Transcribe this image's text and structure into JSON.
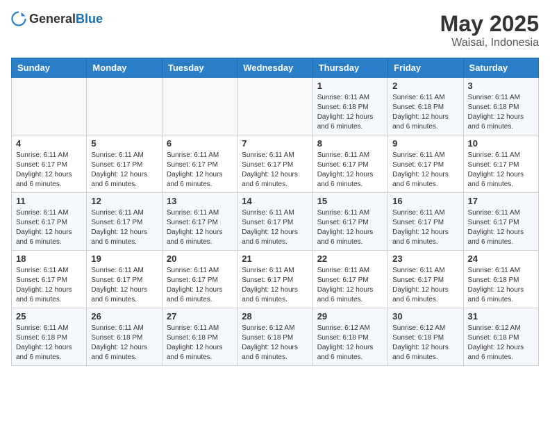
{
  "header": {
    "logo_general": "General",
    "logo_blue": "Blue",
    "month_year": "May 2025",
    "location": "Waisai, Indonesia"
  },
  "weekdays": [
    "Sunday",
    "Monday",
    "Tuesday",
    "Wednesday",
    "Thursday",
    "Friday",
    "Saturday"
  ],
  "weeks": [
    [
      {
        "day": "",
        "info": ""
      },
      {
        "day": "",
        "info": ""
      },
      {
        "day": "",
        "info": ""
      },
      {
        "day": "",
        "info": ""
      },
      {
        "day": "1",
        "info": "Sunrise: 6:11 AM\nSunset: 6:18 PM\nDaylight: 12 hours and 6 minutes."
      },
      {
        "day": "2",
        "info": "Sunrise: 6:11 AM\nSunset: 6:18 PM\nDaylight: 12 hours and 6 minutes."
      },
      {
        "day": "3",
        "info": "Sunrise: 6:11 AM\nSunset: 6:18 PM\nDaylight: 12 hours and 6 minutes."
      }
    ],
    [
      {
        "day": "4",
        "info": "Sunrise: 6:11 AM\nSunset: 6:17 PM\nDaylight: 12 hours and 6 minutes."
      },
      {
        "day": "5",
        "info": "Sunrise: 6:11 AM\nSunset: 6:17 PM\nDaylight: 12 hours and 6 minutes."
      },
      {
        "day": "6",
        "info": "Sunrise: 6:11 AM\nSunset: 6:17 PM\nDaylight: 12 hours and 6 minutes."
      },
      {
        "day": "7",
        "info": "Sunrise: 6:11 AM\nSunset: 6:17 PM\nDaylight: 12 hours and 6 minutes."
      },
      {
        "day": "8",
        "info": "Sunrise: 6:11 AM\nSunset: 6:17 PM\nDaylight: 12 hours and 6 minutes."
      },
      {
        "day": "9",
        "info": "Sunrise: 6:11 AM\nSunset: 6:17 PM\nDaylight: 12 hours and 6 minutes."
      },
      {
        "day": "10",
        "info": "Sunrise: 6:11 AM\nSunset: 6:17 PM\nDaylight: 12 hours and 6 minutes."
      }
    ],
    [
      {
        "day": "11",
        "info": "Sunrise: 6:11 AM\nSunset: 6:17 PM\nDaylight: 12 hours and 6 minutes."
      },
      {
        "day": "12",
        "info": "Sunrise: 6:11 AM\nSunset: 6:17 PM\nDaylight: 12 hours and 6 minutes."
      },
      {
        "day": "13",
        "info": "Sunrise: 6:11 AM\nSunset: 6:17 PM\nDaylight: 12 hours and 6 minutes."
      },
      {
        "day": "14",
        "info": "Sunrise: 6:11 AM\nSunset: 6:17 PM\nDaylight: 12 hours and 6 minutes."
      },
      {
        "day": "15",
        "info": "Sunrise: 6:11 AM\nSunset: 6:17 PM\nDaylight: 12 hours and 6 minutes."
      },
      {
        "day": "16",
        "info": "Sunrise: 6:11 AM\nSunset: 6:17 PM\nDaylight: 12 hours and 6 minutes."
      },
      {
        "day": "17",
        "info": "Sunrise: 6:11 AM\nSunset: 6:17 PM\nDaylight: 12 hours and 6 minutes."
      }
    ],
    [
      {
        "day": "18",
        "info": "Sunrise: 6:11 AM\nSunset: 6:17 PM\nDaylight: 12 hours and 6 minutes."
      },
      {
        "day": "19",
        "info": "Sunrise: 6:11 AM\nSunset: 6:17 PM\nDaylight: 12 hours and 6 minutes."
      },
      {
        "day": "20",
        "info": "Sunrise: 6:11 AM\nSunset: 6:17 PM\nDaylight: 12 hours and 6 minutes."
      },
      {
        "day": "21",
        "info": "Sunrise: 6:11 AM\nSunset: 6:17 PM\nDaylight: 12 hours and 6 minutes."
      },
      {
        "day": "22",
        "info": "Sunrise: 6:11 AM\nSunset: 6:17 PM\nDaylight: 12 hours and 6 minutes."
      },
      {
        "day": "23",
        "info": "Sunrise: 6:11 AM\nSunset: 6:17 PM\nDaylight: 12 hours and 6 minutes."
      },
      {
        "day": "24",
        "info": "Sunrise: 6:11 AM\nSunset: 6:18 PM\nDaylight: 12 hours and 6 minutes."
      }
    ],
    [
      {
        "day": "25",
        "info": "Sunrise: 6:11 AM\nSunset: 6:18 PM\nDaylight: 12 hours and 6 minutes."
      },
      {
        "day": "26",
        "info": "Sunrise: 6:11 AM\nSunset: 6:18 PM\nDaylight: 12 hours and 6 minutes."
      },
      {
        "day": "27",
        "info": "Sunrise: 6:11 AM\nSunset: 6:18 PM\nDaylight: 12 hours and 6 minutes."
      },
      {
        "day": "28",
        "info": "Sunrise: 6:12 AM\nSunset: 6:18 PM\nDaylight: 12 hours and 6 minutes."
      },
      {
        "day": "29",
        "info": "Sunrise: 6:12 AM\nSunset: 6:18 PM\nDaylight: 12 hours and 6 minutes."
      },
      {
        "day": "30",
        "info": "Sunrise: 6:12 AM\nSunset: 6:18 PM\nDaylight: 12 hours and 6 minutes."
      },
      {
        "day": "31",
        "info": "Sunrise: 6:12 AM\nSunset: 6:18 PM\nDaylight: 12 hours and 6 minutes."
      }
    ]
  ]
}
